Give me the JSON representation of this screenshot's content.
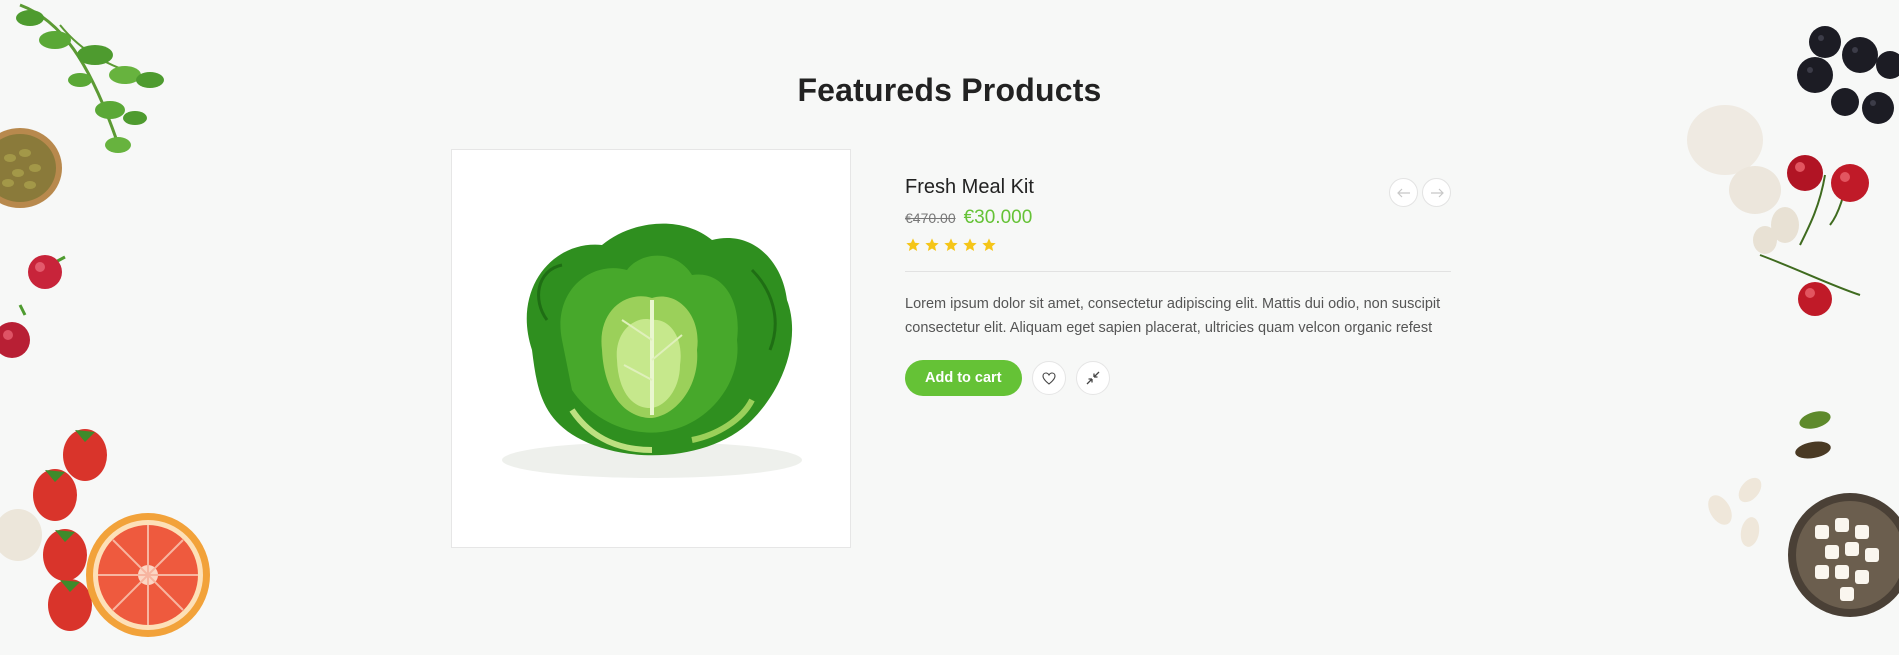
{
  "section": {
    "title": "Featureds Products"
  },
  "product": {
    "name": "Fresh Meal Kit",
    "old_price": "€470.00",
    "new_price": "€30.000",
    "rating": 5,
    "rating_max": 5,
    "description": "Lorem ipsum dolor sit amet, consectetur adipiscing elit. Mattis dui odio, non suscipit consectetur elit. Aliquam eget sapien placerat, ultricies quam velcon organic refest",
    "image": "lettuce-image"
  },
  "actions": {
    "add_to_cart_label": "Add to cart",
    "wishlist_icon": "heart-icon",
    "compare_icon": "compare-icon"
  },
  "carousel": {
    "prev_icon": "arrow-left-icon",
    "next_icon": "arrow-right-icon"
  },
  "colors": {
    "accent": "#65c236",
    "star": "#f5c518",
    "background": "#f7f8f7"
  }
}
